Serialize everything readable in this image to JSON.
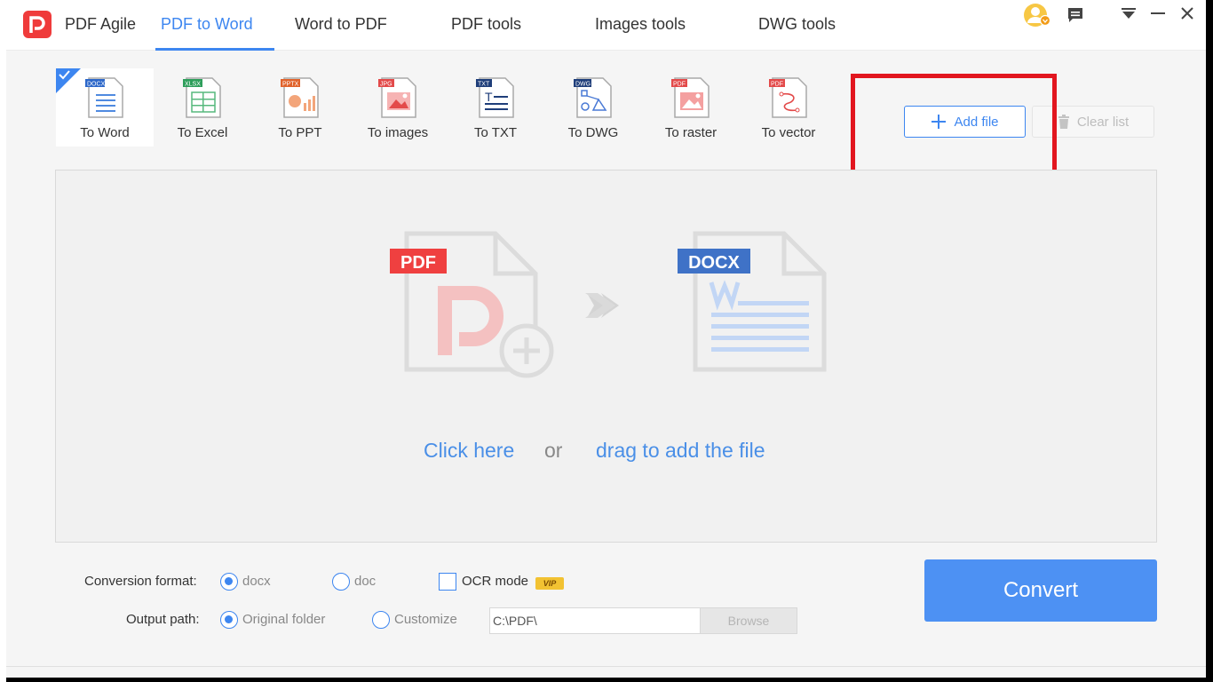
{
  "app": {
    "name": "PDF Agile",
    "nav": [
      {
        "label": "PDF Agile"
      },
      {
        "label": "PDF to Word"
      },
      {
        "label": "Word to PDF"
      },
      {
        "label": "PDF tools"
      },
      {
        "label": "Images tools"
      },
      {
        "label": "DWG tools"
      }
    ],
    "active_nav": "PDF to Word",
    "accent_color": "#3d86f0"
  },
  "tools": [
    {
      "label": "To Word",
      "badge": "DOCX",
      "icon": "word-doc-icon",
      "selected": true
    },
    {
      "label": "To Excel",
      "badge": "XLSX",
      "icon": "excel-doc-icon"
    },
    {
      "label": "To PPT",
      "badge": "PPTX",
      "icon": "ppt-doc-icon"
    },
    {
      "label": "To images",
      "badge": "JPG",
      "icon": "image-doc-icon"
    },
    {
      "label": "To TXT",
      "badge": "TXT",
      "icon": "txt-doc-icon"
    },
    {
      "label": "To DWG",
      "badge": "DWG",
      "icon": "dwg-doc-icon"
    },
    {
      "label": "To raster",
      "badge": "PDF",
      "icon": "raster-doc-icon"
    },
    {
      "label": "To vector",
      "badge": "PDF",
      "icon": "vector-doc-icon"
    }
  ],
  "actions": {
    "add_file": "Add file",
    "clear_list": "Clear list"
  },
  "dropzone": {
    "source_badge": "PDF",
    "target_badge": "DOCX",
    "click_here": "Click here",
    "or": "or",
    "drag_text": "drag to add the file"
  },
  "options": {
    "conversion_format_label": "Conversion format:",
    "format_docx": "docx",
    "format_doc": "doc",
    "selected_format": "docx",
    "ocr_label": "OCR mode",
    "ocr_checked": false,
    "vip_badge": "VIP",
    "output_path_label": "Output path:",
    "path_original": "Original folder",
    "path_customize": "Customize",
    "selected_path_option": "Original folder",
    "path_value": "C:\\PDF\\",
    "browse": "Browse"
  },
  "convert": "Convert"
}
